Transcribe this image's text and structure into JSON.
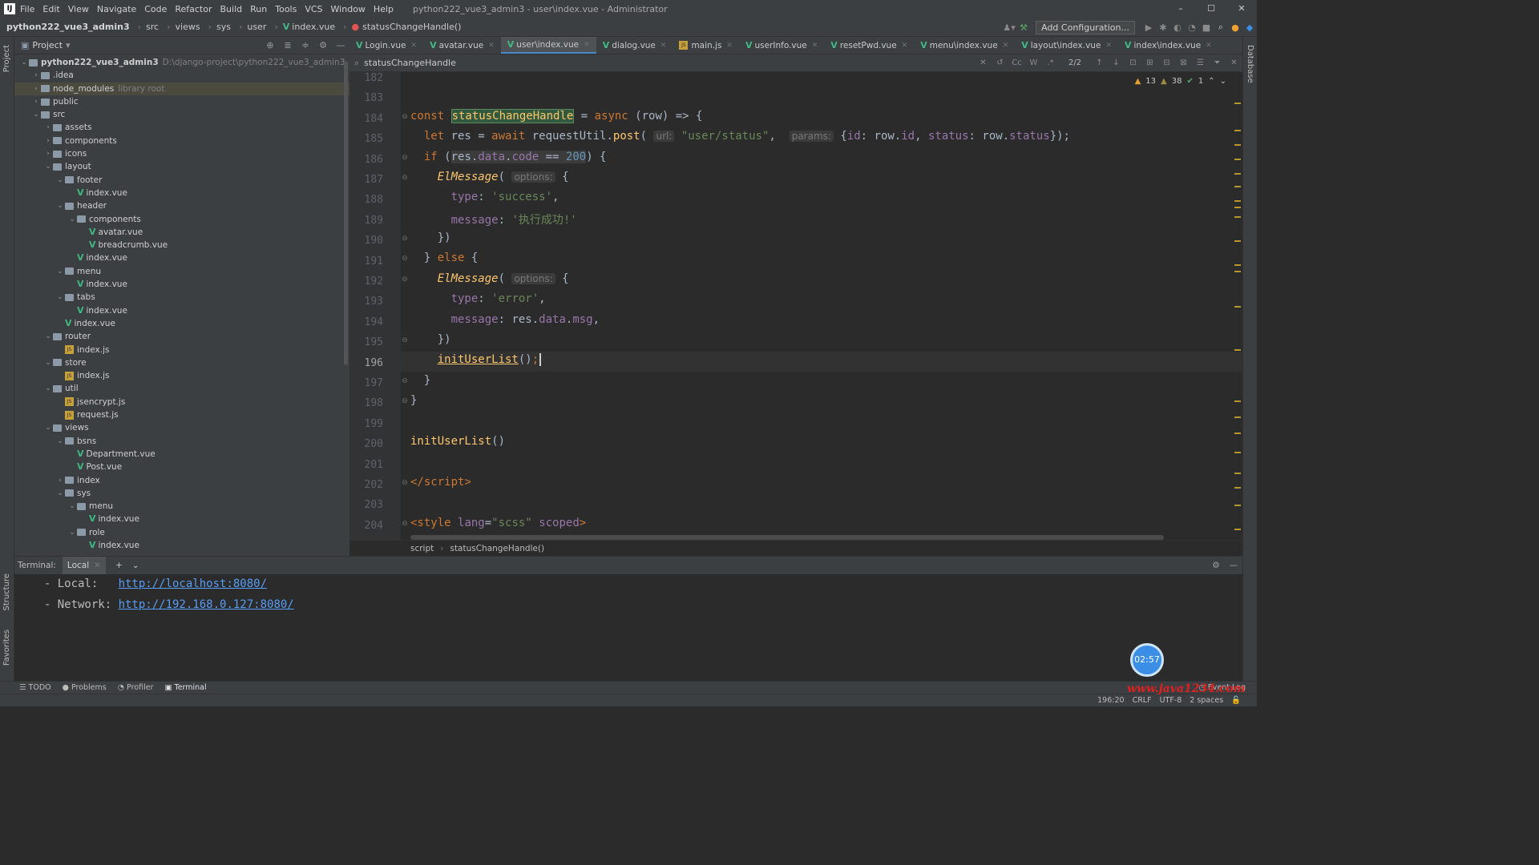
{
  "titlebar": {
    "menu": [
      "File",
      "Edit",
      "View",
      "Navigate",
      "Code",
      "Refactor",
      "Build",
      "Run",
      "Tools",
      "VCS",
      "Window",
      "Help"
    ],
    "title": "python222_vue3_admin3 - user\\index.vue - Administrator"
  },
  "navbar": {
    "crumbs": [
      "python222_vue3_admin3",
      "src",
      "views",
      "sys",
      "user",
      "index.vue",
      "statusChangeHandle()"
    ],
    "add_config": "Add Configuration..."
  },
  "project": {
    "header": "Project",
    "tree": [
      {
        "d": 0,
        "t": "folder",
        "open": true,
        "label": "python222_vue3_admin3",
        "extra": "D:\\django-project\\python222_vue3_admin3",
        "bold": true
      },
      {
        "d": 1,
        "t": "folder",
        "open": false,
        "label": ".idea"
      },
      {
        "d": 1,
        "t": "folder",
        "open": false,
        "label": "node_modules",
        "extra": "library root",
        "sel": true
      },
      {
        "d": 1,
        "t": "folder",
        "open": false,
        "label": "public"
      },
      {
        "d": 1,
        "t": "folder",
        "open": true,
        "label": "src"
      },
      {
        "d": 2,
        "t": "folder",
        "open": false,
        "label": "assets"
      },
      {
        "d": 2,
        "t": "folder",
        "open": false,
        "label": "components"
      },
      {
        "d": 2,
        "t": "folder",
        "open": false,
        "label": "icons"
      },
      {
        "d": 2,
        "t": "folder",
        "open": true,
        "label": "layout"
      },
      {
        "d": 3,
        "t": "folder",
        "open": true,
        "label": "footer"
      },
      {
        "d": 4,
        "t": "vue",
        "label": "index.vue"
      },
      {
        "d": 3,
        "t": "folder",
        "open": true,
        "label": "header"
      },
      {
        "d": 4,
        "t": "folder",
        "open": true,
        "label": "components"
      },
      {
        "d": 5,
        "t": "vue",
        "label": "avatar.vue"
      },
      {
        "d": 5,
        "t": "vue",
        "label": "breadcrumb.vue"
      },
      {
        "d": 4,
        "t": "vue",
        "label": "index.vue"
      },
      {
        "d": 3,
        "t": "folder",
        "open": true,
        "label": "menu"
      },
      {
        "d": 4,
        "t": "vue",
        "label": "index.vue"
      },
      {
        "d": 3,
        "t": "folder",
        "open": true,
        "label": "tabs"
      },
      {
        "d": 4,
        "t": "vue",
        "label": "index.vue"
      },
      {
        "d": 3,
        "t": "vue",
        "label": "index.vue"
      },
      {
        "d": 2,
        "t": "folder",
        "open": true,
        "label": "router"
      },
      {
        "d": 3,
        "t": "js",
        "label": "index.js"
      },
      {
        "d": 2,
        "t": "folder",
        "open": true,
        "label": "store"
      },
      {
        "d": 3,
        "t": "js",
        "label": "index.js"
      },
      {
        "d": 2,
        "t": "folder",
        "open": true,
        "label": "util"
      },
      {
        "d": 3,
        "t": "js",
        "label": "jsencrypt.js"
      },
      {
        "d": 3,
        "t": "js",
        "label": "request.js"
      },
      {
        "d": 2,
        "t": "folder",
        "open": true,
        "label": "views"
      },
      {
        "d": 3,
        "t": "folder",
        "open": true,
        "label": "bsns"
      },
      {
        "d": 4,
        "t": "vue",
        "label": "Department.vue"
      },
      {
        "d": 4,
        "t": "vue",
        "label": "Post.vue"
      },
      {
        "d": 3,
        "t": "folder",
        "open": false,
        "label": "index"
      },
      {
        "d": 3,
        "t": "folder",
        "open": true,
        "label": "sys"
      },
      {
        "d": 4,
        "t": "folder",
        "open": true,
        "label": "menu"
      },
      {
        "d": 5,
        "t": "vue",
        "label": "index.vue"
      },
      {
        "d": 4,
        "t": "folder",
        "open": true,
        "label": "role"
      },
      {
        "d": 5,
        "t": "vue",
        "label": "index.vue"
      }
    ]
  },
  "tabs": [
    {
      "label": "Login.vue",
      "icon": "vue"
    },
    {
      "label": "avatar.vue",
      "icon": "vue"
    },
    {
      "label": "user\\index.vue",
      "icon": "vue",
      "active": true
    },
    {
      "label": "dialog.vue",
      "icon": "vue"
    },
    {
      "label": "main.js",
      "icon": "js"
    },
    {
      "label": "userInfo.vue",
      "icon": "vue"
    },
    {
      "label": "resetPwd.vue",
      "icon": "vue"
    },
    {
      "label": "menu\\index.vue",
      "icon": "vue"
    },
    {
      "label": "layout\\index.vue",
      "icon": "vue"
    },
    {
      "label": "index\\index.vue",
      "icon": "vue"
    }
  ],
  "search": {
    "query": "statusChangeHandle",
    "count": "2/2"
  },
  "inspections": {
    "warnings": "13",
    "weak": "38",
    "ok": "1"
  },
  "line_numbers": [
    "182",
    "183",
    "184",
    "185",
    "186",
    "187",
    "188",
    "189",
    "190",
    "191",
    "192",
    "193",
    "194",
    "195",
    "196",
    "197",
    "198",
    "199",
    "200",
    "201",
    "202",
    "203",
    "204"
  ],
  "current_line": "196",
  "code_breadcrumb": [
    "script",
    "statusChangeHandle()"
  ],
  "terminal": {
    "label": "Terminal:",
    "tab": "Local",
    "lines": [
      {
        "prefix": "  - Local:   ",
        "url": "http://localhost:8080/"
      },
      {
        "prefix": "  - Network: ",
        "url": "http://192.168.0.127:8080/"
      }
    ],
    "timer": "02:57"
  },
  "toolwindows": [
    "TODO",
    "Problems",
    "Profiler",
    "Terminal"
  ],
  "event_log": "Event Log",
  "status": {
    "position": "196:20",
    "line_sep": "CRLF",
    "encoding": "UTF-8",
    "indent": "2 spaces"
  },
  "watermark": "www.java1234.com",
  "side_labels": {
    "left_top": "Project",
    "left_mid": "Structure",
    "left_bot": "Favorites",
    "right": "Database"
  }
}
